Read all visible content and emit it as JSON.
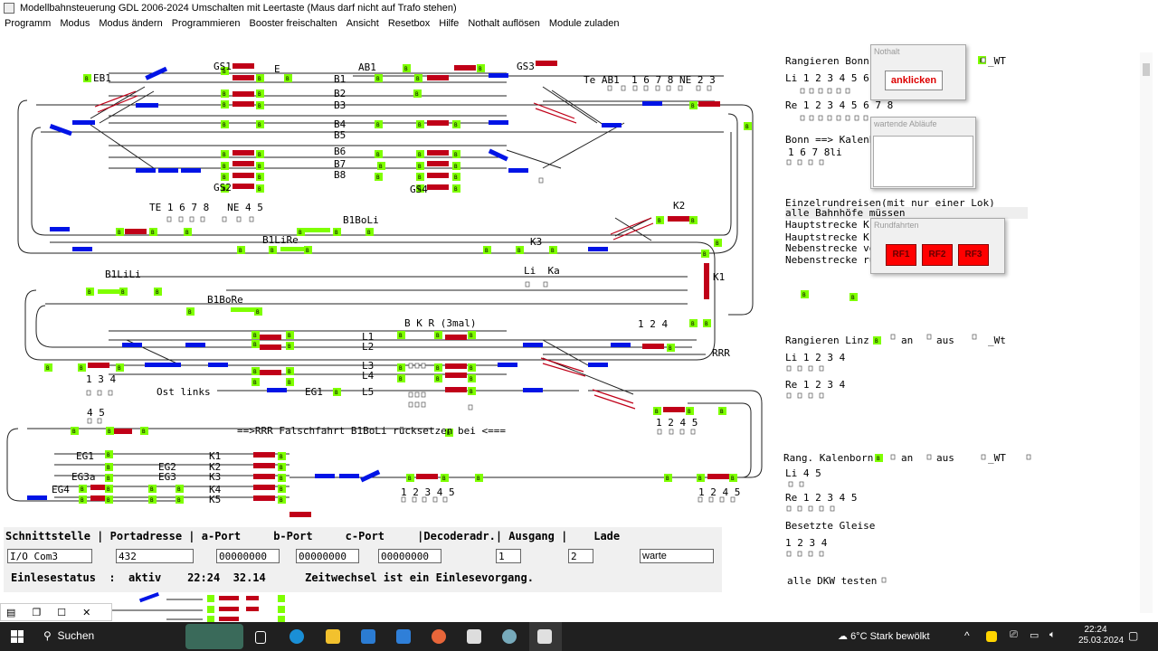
{
  "window": {
    "title": "Modellbahnsteuerung GDL 2006-2024 Umschalten mit Leertaste (Maus darf nicht auf Trafo stehen)"
  },
  "menu": [
    "Programm",
    "Modus",
    "Modus ändern",
    "Programmieren",
    "Booster freischalten",
    "Ansicht",
    "Resetbox",
    "Hilfe",
    "Nothalt auflösen",
    "Module zuladen"
  ],
  "track": {
    "top": [
      "GS1",
      "E",
      "AB1",
      "GS3",
      "EB1",
      "B1",
      "B2",
      "B3",
      "B4",
      "B5",
      "B6",
      "B7",
      "B8",
      "GS2",
      "GS4",
      "Te AB1  1 6 7 8 NE 2 3",
      "TE 1 6 7 8   NE 4 5",
      "B1BoLi",
      "B1LiRe",
      "K3",
      "Li  Ka",
      "K2",
      "K1"
    ],
    "mid": [
      "B1LiLi",
      "B1BoRe",
      "B K R (3mal)",
      "1 2 4",
      "L1",
      "L2",
      "L3",
      "L4",
      "L5",
      "1 3 4",
      "Ost links",
      "EG1",
      "RRR",
      "1 2 4 5"
    ],
    "low": [
      "4 5",
      "==>RRR Falschfahrt B1BoLi rücksetzen",
      "bei <===",
      "EG1",
      "EG2",
      "EG3",
      "EG3a",
      "EG4",
      "K1",
      "K2",
      "K3",
      "K4",
      "K5",
      "1 2 3 4 5",
      "1 2 4 5"
    ]
  },
  "right": {
    "lines": [
      "Rangieren Bonn",
      "_WT",
      "Li 1 2 3 4 5 6",
      "Re 1 2 3 4 5 6 7 8",
      "Bonn ==> Kalenb",
      "1 6 7 8li",
      "Einzelrundreisen(mit nur einer Lok)",
      "alle Bahnhöfe müssen",
      "Hauptstrecke Kr",
      "Hauptstrecke Kr",
      "Nebenstrecke vo",
      "Nebenstrecke rü",
      "Rangieren Linz",
      "an",
      "aus",
      "_Wt",
      "Li 1 2 3 4",
      "Re 1 2 3 4",
      "Rang. Kalenborn",
      "an",
      "aus",
      "_WT",
      "Li 4 5",
      "Re 1 2 3 4 5",
      "Besetzte Gleise",
      "1 2 3 4",
      "alle DKW testen"
    ]
  },
  "popups": {
    "nothalt": {
      "title": "Nothalt",
      "button": "anklicken"
    },
    "wartende": {
      "title": "wartende Abläufe"
    },
    "rundfahrten": {
      "title": "Rundfahrten",
      "buttons": [
        "RF1",
        "RF2",
        "RF3"
      ]
    }
  },
  "status": {
    "header": "Schnittstelle | Portadresse | a-Port     b-Port     c-Port     |Decoderadr.| Ausgang |    Lade",
    "iface": "I/O Com3",
    "port": "432",
    "aport": "00000000",
    "bport": "00000000",
    "cport": "00000000",
    "decoder": "1",
    "ausgang": "2",
    "lade": "warte",
    "line": "Einlesestatus  :  aktiv    22:24  32.14      Zeitwechsel ist ein Einlesevorgang."
  },
  "taskbar": {
    "search": "Suchen",
    "weather": "6°C  Stark bewölkt",
    "time": "22:24",
    "date": "25.03.2024"
  },
  "marker": "B",
  "colors": {
    "green": "#7fff00",
    "red": "#c00018",
    "blue": "#0014e6"
  }
}
